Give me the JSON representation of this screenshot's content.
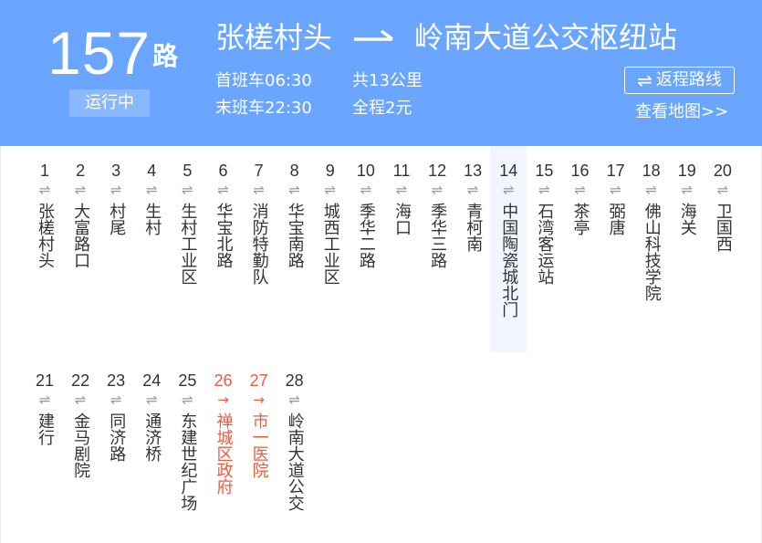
{
  "route": {
    "number": "157",
    "suffix": "路",
    "status": "运行中"
  },
  "title": {
    "from": "张槎村头",
    "arrow": "—",
    "to": "岭南大道公交枢纽站"
  },
  "info": {
    "first_bus": "首班车06:30",
    "last_bus": "末班车22:30",
    "distance": "共13公里",
    "fare": "全程2元"
  },
  "actions": {
    "return_label": "返程路线",
    "map_label": "查看地图>>"
  },
  "icons": {
    "two_way": "⇌",
    "one_way": "→"
  },
  "colors": {
    "header_bg": "#6aa5ff",
    "single_direction": "#f25a3c",
    "highlight_bg": "#f1f6fe"
  },
  "highlighted_station": 14,
  "stations": [
    {
      "index": "1",
      "name": "张槎村头",
      "direction": "⇌"
    },
    {
      "index": "2",
      "name": "大富路口",
      "direction": "⇌"
    },
    {
      "index": "3",
      "name": "村尾",
      "direction": "⇌"
    },
    {
      "index": "4",
      "name": "生村",
      "direction": "⇌"
    },
    {
      "index": "5",
      "name": "生村工业区",
      "direction": "⇌"
    },
    {
      "index": "6",
      "name": "华宝北路",
      "direction": "⇌"
    },
    {
      "index": "7",
      "name": "消防特勤队",
      "direction": "⇌"
    },
    {
      "index": "8",
      "name": "华宝南路",
      "direction": "⇌"
    },
    {
      "index": "9",
      "name": "城西工业区",
      "direction": "⇌"
    },
    {
      "index": "10",
      "name": "季华二路",
      "direction": "⇌"
    },
    {
      "index": "11",
      "name": "海口",
      "direction": "⇌"
    },
    {
      "index": "12",
      "name": "季华三路",
      "direction": "⇌"
    },
    {
      "index": "13",
      "name": "青柯南",
      "direction": "⇌"
    },
    {
      "index": "14",
      "name": "中国陶瓷城北门",
      "direction": "⇌"
    },
    {
      "index": "15",
      "name": "石湾客运站",
      "direction": "⇌"
    },
    {
      "index": "16",
      "name": "茶亭",
      "direction": "⇌"
    },
    {
      "index": "17",
      "name": "弼唐",
      "direction": "⇌"
    },
    {
      "index": "18",
      "name": "佛山科技学院",
      "direction": "⇌"
    },
    {
      "index": "19",
      "name": "海关",
      "direction": "⇌"
    },
    {
      "index": "20",
      "name": "卫国西",
      "direction": "⇌"
    },
    {
      "index": "21",
      "name": "建行",
      "direction": "⇌"
    },
    {
      "index": "22",
      "name": "金马剧院",
      "direction": "⇌"
    },
    {
      "index": "23",
      "name": "同济路",
      "direction": "⇌"
    },
    {
      "index": "24",
      "name": "通济桥",
      "direction": "⇌"
    },
    {
      "index": "25",
      "name": "东建世纪广场",
      "direction": "⇌"
    },
    {
      "index": "26",
      "name": "禅城区政府",
      "direction": "→"
    },
    {
      "index": "27",
      "name": "市一医院",
      "direction": "→"
    },
    {
      "index": "28",
      "name": "岭南大道公交",
      "direction": "⇌"
    }
  ]
}
